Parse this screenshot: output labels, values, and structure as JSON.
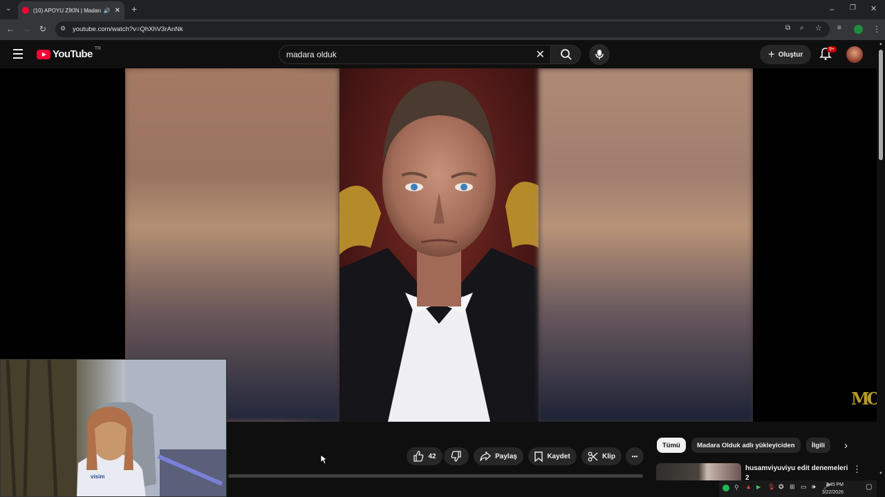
{
  "browser": {
    "tab_title": "(10) APOYU ZİKİN | Madara",
    "url": "youtube.com/watch?v=QhXhV3rAnNk",
    "new_tab": "+",
    "win_min": "–",
    "win_restore": "❐",
    "win_close": "✕"
  },
  "header": {
    "logo_text": "YouTube",
    "country_code": "TR",
    "search_value": "madara olduk",
    "create_label": "Oluştur",
    "notification_badge": "9+"
  },
  "video": {
    "watermark": "MO"
  },
  "actions": {
    "like_count": "42",
    "share_label": "Paylaş",
    "save_label": "Kaydet",
    "clip_label": "Klip",
    "more_label": "•••"
  },
  "chips": [
    {
      "label": "Tümü"
    },
    {
      "label": "Madara Olduk adlı yükleyiciden"
    },
    {
      "label": "İlgili"
    }
  ],
  "recommendation": {
    "title": "husamviyuviyu edit denemeleri",
    "title_cont": "2"
  },
  "webcam": {
    "shirt_text": "visim"
  },
  "taskbar": {
    "time": "7:45 PM",
    "date": "3/22/2026"
  },
  "colors": {
    "brand_red": "#ff0033",
    "badge_red": "#cc0000",
    "background": "#0f0f0f"
  }
}
